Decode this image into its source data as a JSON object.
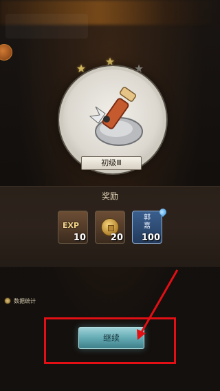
{
  "rank": {
    "label": "初级Ⅲ",
    "stars": [
      "gold",
      "gold",
      "grey"
    ]
  },
  "reward": {
    "title": "奖励",
    "items": [
      {
        "name": "exp",
        "label": "EXP",
        "count": "10"
      },
      {
        "name": "coin",
        "count": "20"
      },
      {
        "name": "card",
        "label": "郭嘉",
        "count": "100"
      }
    ]
  },
  "stats": {
    "label": "数据统计"
  },
  "continue": {
    "label": "继续"
  },
  "colors": {
    "highlight": "#e20f14",
    "button": "#6fb3bb"
  }
}
